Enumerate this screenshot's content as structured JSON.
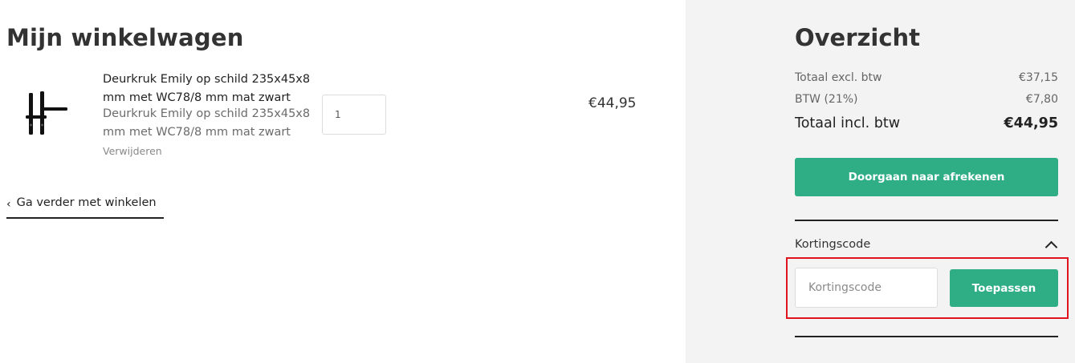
{
  "cart": {
    "title": "Mijn winkelwagen",
    "item": {
      "name": "Deurkruk Emily op schild 235x45x8 mm met WC78/8 mm mat zwart",
      "description": "Deurkruk Emily op schild 235x45x8 mm met WC78/8 mm mat zwart",
      "remove_label": "Verwijderen",
      "quantity": "1",
      "price": "€44,95",
      "image_icon": "door-handle-image"
    },
    "continue_label": "Ga verder met winkelen"
  },
  "summary": {
    "title": "Overzicht",
    "subtotal_label": "Totaal excl. btw",
    "subtotal_value": "€37,15",
    "vat_label": "BTW (21%)",
    "vat_value": "€7,80",
    "total_label": "Totaal incl. btw",
    "total_value": "€44,95",
    "checkout_label": "Doorgaan naar afrekenen",
    "discount": {
      "title": "Kortingscode",
      "placeholder": "Kortingscode",
      "value": "",
      "apply_label": "Toepassen"
    }
  },
  "colors": {
    "accent": "#2fae85",
    "sidebar_bg": "#f3f3f3",
    "highlight": "#e0141e"
  }
}
